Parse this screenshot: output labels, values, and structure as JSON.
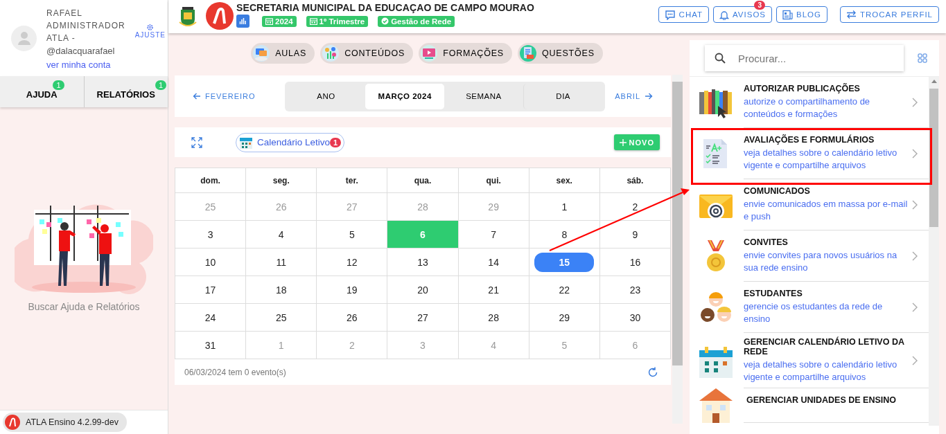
{
  "sidebar": {
    "user": {
      "name": "RAFAEL ADMINISTRADOR ATLA -",
      "handle": "@dalacquarafael",
      "account_link": "ver minha conta",
      "settings": "AJUSTE"
    },
    "tabs": [
      {
        "label": "AJUDA",
        "badge": "1"
      },
      {
        "label": "RELATÓRIOS",
        "badge": "1"
      }
    ],
    "empty_message": "Buscar Ajuda e Relatórios",
    "version": "ATLA Ensino 4.2.99-dev"
  },
  "header": {
    "title": "SECRETARIA MUNICIPAL DA EDUCAÇAO DE CAMPO MOURAO",
    "chips": [
      {
        "label": "2024",
        "kind": "calendar"
      },
      {
        "label": "1º Trimestre",
        "kind": "calendar"
      },
      {
        "label": "Gestão de Rede",
        "kind": "check"
      }
    ],
    "buttons": [
      {
        "label": "CHAT",
        "kind": "chat"
      },
      {
        "label": "AVISOS",
        "kind": "bell",
        "badge": "3"
      },
      {
        "label": "BLOG",
        "kind": "news"
      },
      {
        "label": "TROCAR PERFIL",
        "kind": "swap"
      }
    ]
  },
  "nav_pills": [
    {
      "label": "AULAS",
      "kind": "lessons"
    },
    {
      "label": "CONTEÚDOS",
      "kind": "contents"
    },
    {
      "label": "FORMAÇÕES",
      "kind": "training"
    },
    {
      "label": "QUESTÕES",
      "kind": "questions"
    }
  ],
  "calendar": {
    "prev": "FEVEREIRO",
    "next": "ABRIL",
    "views": [
      {
        "label": "ANO",
        "selected": false
      },
      {
        "label": "MARÇO 2024",
        "selected": true
      },
      {
        "label": "SEMANA",
        "selected": false
      },
      {
        "label": "DIA",
        "selected": false
      }
    ],
    "filter": {
      "label": "Calendário Letivo",
      "badge": "1"
    },
    "new_button": "NOVO",
    "weekdays": [
      "dom.",
      "seg.",
      "ter.",
      "qua.",
      "qui.",
      "sex.",
      "sáb."
    ],
    "weeks": [
      [
        {
          "day": "25",
          "kind": "outside"
        },
        {
          "day": "26",
          "kind": "outside"
        },
        {
          "day": "27",
          "kind": "outside"
        },
        {
          "day": "28",
          "kind": "outside"
        },
        {
          "day": "29",
          "kind": "outside"
        },
        {
          "day": "1",
          "kind": "day"
        },
        {
          "day": "2",
          "kind": "day"
        }
      ],
      [
        {
          "day": "3",
          "kind": "day"
        },
        {
          "day": "4",
          "kind": "day"
        },
        {
          "day": "5",
          "kind": "day"
        },
        {
          "day": "6",
          "kind": "today"
        },
        {
          "day": "7",
          "kind": "day"
        },
        {
          "day": "8",
          "kind": "day"
        },
        {
          "day": "9",
          "kind": "day"
        }
      ],
      [
        {
          "day": "10",
          "kind": "day"
        },
        {
          "day": "11",
          "kind": "day"
        },
        {
          "day": "12",
          "kind": "day"
        },
        {
          "day": "13",
          "kind": "day"
        },
        {
          "day": "14",
          "kind": "day"
        },
        {
          "day": "15",
          "kind": "selected"
        },
        {
          "day": "16",
          "kind": "day"
        }
      ],
      [
        {
          "day": "17",
          "kind": "day"
        },
        {
          "day": "18",
          "kind": "day"
        },
        {
          "day": "19",
          "kind": "day"
        },
        {
          "day": "20",
          "kind": "day"
        },
        {
          "day": "21",
          "kind": "day"
        },
        {
          "day": "22",
          "kind": "day"
        },
        {
          "day": "23",
          "kind": "day"
        }
      ],
      [
        {
          "day": "24",
          "kind": "day"
        },
        {
          "day": "25",
          "kind": "day"
        },
        {
          "day": "26",
          "kind": "day"
        },
        {
          "day": "27",
          "kind": "day"
        },
        {
          "day": "28",
          "kind": "day"
        },
        {
          "day": "29",
          "kind": "day"
        },
        {
          "day": "30",
          "kind": "day"
        }
      ],
      [
        {
          "day": "31",
          "kind": "day"
        },
        {
          "day": "1",
          "kind": "outside"
        },
        {
          "day": "2",
          "kind": "outside"
        },
        {
          "day": "3",
          "kind": "outside"
        },
        {
          "day": "4",
          "kind": "outside"
        },
        {
          "day": "5",
          "kind": "outside"
        },
        {
          "day": "6",
          "kind": "outside"
        }
      ]
    ],
    "footer": "06/03/2024 tem 0 evento(s)"
  },
  "right_panel": {
    "search": {
      "placeholder": "Procurar..."
    },
    "items": [
      {
        "title": "AUTORIZAR PUBLICAÇÕES",
        "description": "autorize o compartilhamento de conteúdos e formações",
        "kind": "books"
      },
      {
        "title": "AVALIAÇÕES E FORMULÁRIOS",
        "description": "veja detalhes sobre o calendário letivo vigente e compartilhe arquivos",
        "kind": "form"
      },
      {
        "title": "COMUNICADOS",
        "description": "envie comunicados em massa por e-mail e push",
        "kind": "mail"
      },
      {
        "title": "CONVITES",
        "description": "envie convites para novos usuários na sua rede ensino",
        "kind": "medal"
      },
      {
        "title": "ESTUDANTES",
        "description": "gerencie os estudantes da rede de ensino",
        "kind": "kids"
      },
      {
        "title": "GERENCIAR CALENDÁRIO LETIVO DA REDE",
        "description": "veja detalhes sobre o calendário letivo vigente e compartilhe arquivos",
        "kind": "calendar"
      },
      {
        "title": "GERENCIAR UNIDADES DE ENSINO",
        "kind": "school"
      }
    ]
  }
}
